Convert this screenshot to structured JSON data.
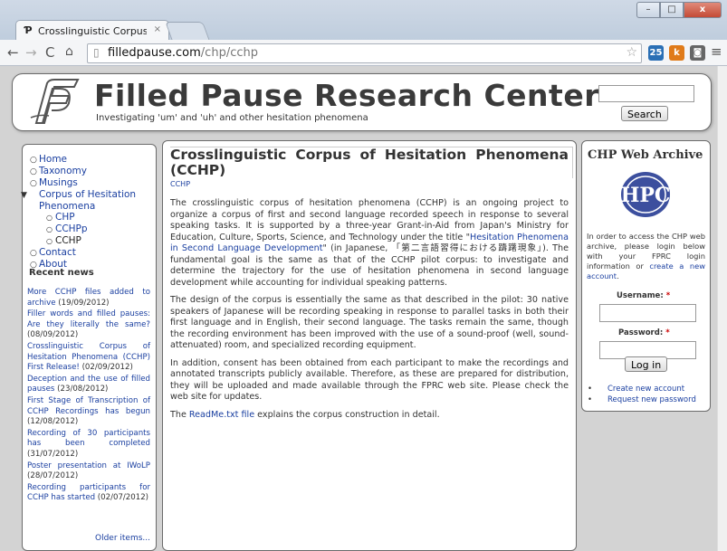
{
  "browser": {
    "tab_title": "Crosslinguistic Corpus of",
    "tab_close": "×",
    "url_domain": "filledpause.com",
    "url_path": "/chp/cchp",
    "ext_badge_count": "25",
    "ext_k_label": "k"
  },
  "header": {
    "title": "Filled Pause Research Center",
    "subtitle": "Investigating 'um' and 'uh' and other hesitation phenomena",
    "search_button": "Search"
  },
  "nav": {
    "items": [
      "Home",
      "Taxonomy",
      "Musings"
    ],
    "expanded_label": "Corpus of Hesitation Phenomena",
    "sub_items": [
      "CHP",
      "CCHPp",
      "CCHP"
    ],
    "after_items": [
      "Contact",
      "About"
    ]
  },
  "recent_news": {
    "heading": "Recent news",
    "items": [
      {
        "title": "More CCHP files added to archive",
        "date": "(19/09/2012)"
      },
      {
        "title": "Filler words and filled pauses: Are they literally the same?",
        "date": "(08/09/2012)"
      },
      {
        "title": "Crosslinguistic Corpus of Hesitation Phenomena (CCHP) First Release!",
        "date": "(02/09/2012)"
      },
      {
        "title": "Deception and the use of filled pauses",
        "date": "(23/08/2012)"
      },
      {
        "title": "First Stage of Transcription of CCHP Recordings has begun",
        "date": "(12/08/2012)"
      },
      {
        "title": "Recording of 30 participants has been completed",
        "date": "(31/07/2012)"
      },
      {
        "title": "Poster presentation at IWoLP",
        "date": "(28/07/2012)"
      },
      {
        "title": "Recording participants for CCHP has started",
        "date": "(02/07/2012)"
      }
    ],
    "older": "Older items..."
  },
  "main": {
    "title": "Crosslinguistic Corpus of Hesitation Phenomena (CCHP)",
    "tag": "CCHP",
    "p1_a": "The crosslinguistic corpus of hesitation phenomena (CCHP) is an ongoing project to organize a corpus of first and second language recorded speech in response to several speaking tasks. It is supported by a three-year Grant-in-Aid from Japan's Ministry for Education, Culture, Sports, Science, and Technology under the title \"",
    "p1_link": "Hesitation Phenomena in Second Language Development",
    "p1_b": "\" (in Japanese, 「第二言語習得における躊躇現象」). The fundamental goal is the same as that of the CCHP pilot corpus: to investigate and determine the trajectory for the use of hesitation phenomena in second language development while accounting for individual speaking patterns.",
    "p2": "The design of the corpus is essentially the same as that described in the pilot: 30 native speakers of Japanese will be recording speaking in response to parallel tasks in both their first language and in English, their second language. The tasks remain the same, though the recording environment has been improved with the use of a sound-proof (well, sound-attenuated) room, and specialized recording equipment.",
    "p3": "In addition, consent has been obtained from each participant to make the recordings and annotated transcripts publicly available. Therefore, as these are prepared for distribution, they will be uploaded and made available through the FPRC web site. Please check the web site for updates.",
    "p4_pre": "The ",
    "p4_link": "ReadMe.txt file",
    "p4_post": " explains the corpus construction in detail."
  },
  "archive": {
    "title": "CHP Web Archive",
    "logo_text": "HPC",
    "intro_a": "In order to access the CHP web archive, please login below with your FPRC login information or ",
    "intro_link": "create a new account",
    "intro_b": ".",
    "username_label": "Username:",
    "password_label": "Password:",
    "required_mark": "*",
    "login_button": "Log in",
    "links": [
      "Create new account",
      "Request new password"
    ],
    "link_bullet": "•"
  }
}
